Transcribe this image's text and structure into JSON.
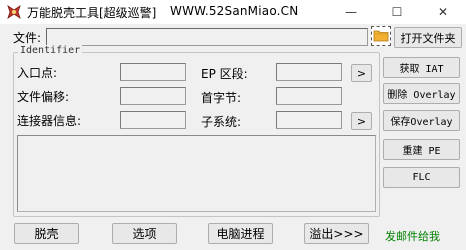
{
  "window": {
    "title": "万能脱壳工具[超级巡警]",
    "site": "WWW.52SanMiao.CN",
    "minimize_glyph": "—",
    "maximize_glyph": "☐",
    "close_glyph": "✕"
  },
  "file": {
    "label": "文件:",
    "value": "",
    "open_button": "打开文件夹",
    "browse_icon": "folder-icon"
  },
  "identifier": {
    "group_title": "Identifier",
    "entry_point_label": "入口点:",
    "entry_point_value": "",
    "file_offset_label": "文件偏移:",
    "file_offset_value": "",
    "linker_info_label": "连接器信息:",
    "linker_info_value": "",
    "ep_section_label": "EP 区段:",
    "ep_section_value": "",
    "first_byte_label": "首字节:",
    "first_byte_value": "",
    "subsystem_label": "子系统:",
    "subsystem_value": "",
    "arrow_label": ">",
    "output": ""
  },
  "side_buttons": {
    "get_iat": "获取 IAT",
    "delete_overlay": "删除 Overlay",
    "save_overlay": "保存Overlay",
    "rebuild_pe": "重建 PE",
    "flc": "FLC"
  },
  "bottom": {
    "unpack": "脱壳",
    "options": "选项",
    "process": "电脑进程",
    "overflow": "溢出>>>",
    "promo": "发邮件给我"
  },
  "colors": {
    "promo": "#008000",
    "window_bg": "#f0f0f0"
  }
}
